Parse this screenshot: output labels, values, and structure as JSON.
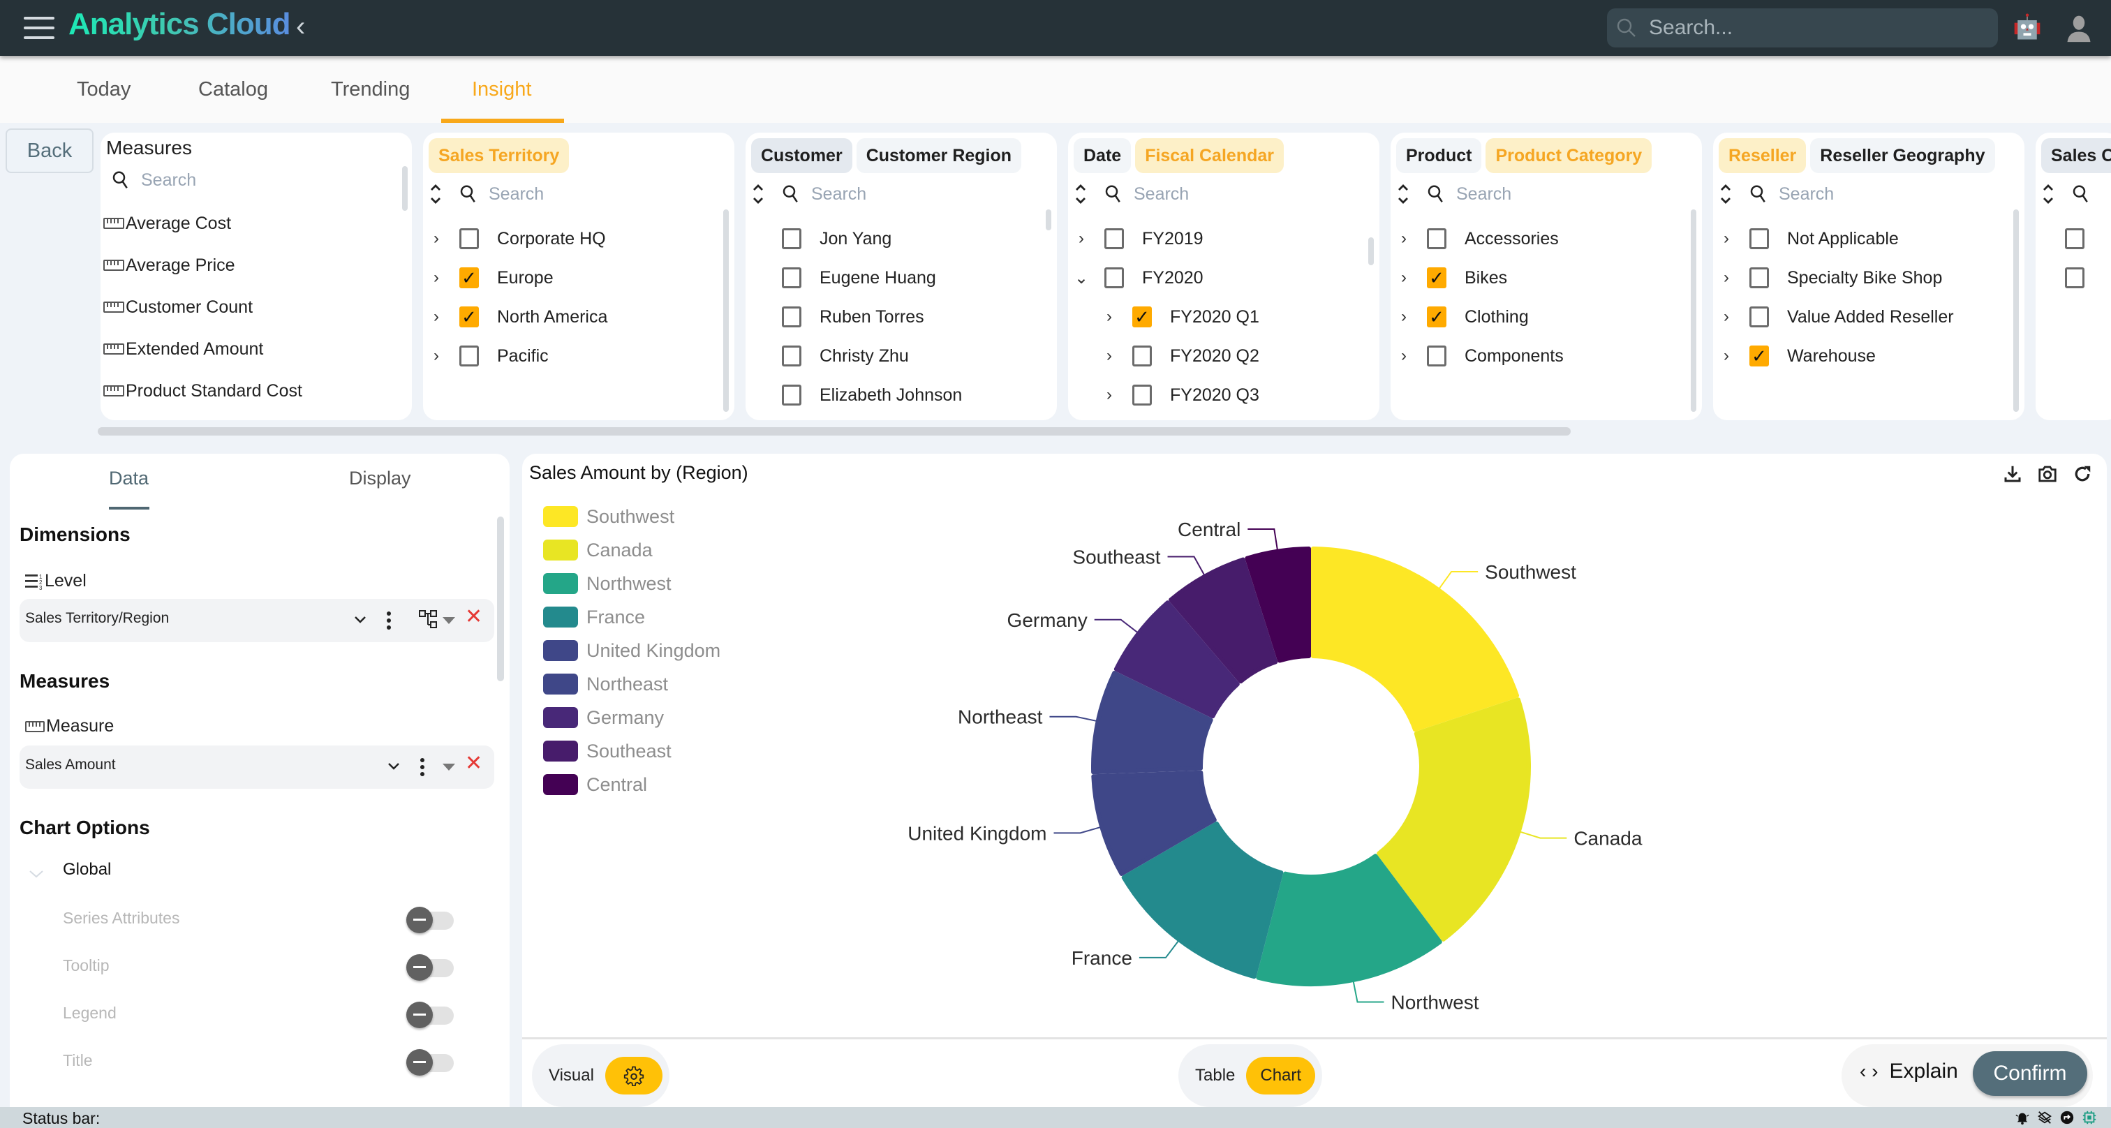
{
  "app": {
    "title": "Analytics Cloud",
    "search_placeholder": "Search..."
  },
  "nav": {
    "tabs": [
      {
        "label": "Today",
        "active": false
      },
      {
        "label": "Catalog",
        "active": false
      },
      {
        "label": "Trending",
        "active": false
      },
      {
        "label": "Insight",
        "active": true
      }
    ]
  },
  "filters": {
    "back_label": "Back",
    "measures_panel": {
      "title": "Measures",
      "search_placeholder": "Search",
      "items": [
        "Average Cost",
        "Average Price",
        "Customer Count",
        "Extended Amount",
        "Product Standard Cost"
      ]
    },
    "search_placeholder": "Search",
    "panels": [
      {
        "chips": [
          {
            "label": "Sales Territory",
            "selected": true
          }
        ],
        "items": [
          {
            "label": "Corporate HQ",
            "checked": false,
            "expander": "›"
          },
          {
            "label": "Europe",
            "checked": true,
            "expander": "›"
          },
          {
            "label": "North America",
            "checked": true,
            "expander": "›"
          },
          {
            "label": "Pacific",
            "checked": false,
            "expander": "›"
          }
        ]
      },
      {
        "chips": [
          {
            "label": "Customer",
            "selected": false,
            "grey": true
          },
          {
            "label": "Customer Region",
            "selected": false
          }
        ],
        "items": [
          {
            "label": "Jon Yang",
            "checked": false,
            "expander": ""
          },
          {
            "label": "Eugene Huang",
            "checked": false,
            "expander": ""
          },
          {
            "label": "Ruben Torres",
            "checked": false,
            "expander": ""
          },
          {
            "label": "Christy Zhu",
            "checked": false,
            "expander": ""
          },
          {
            "label": "Elizabeth Johnson",
            "checked": false,
            "expander": ""
          }
        ]
      },
      {
        "chips": [
          {
            "label": "Date",
            "selected": false
          },
          {
            "label": "Fiscal Calendar",
            "selected": true
          }
        ],
        "items": [
          {
            "label": "FY2019",
            "checked": false,
            "expander": "›",
            "indent": 0
          },
          {
            "label": "FY2020",
            "checked": false,
            "expander": "⌄",
            "indent": 0
          },
          {
            "label": "FY2020 Q1",
            "checked": true,
            "expander": "›",
            "indent": 1
          },
          {
            "label": "FY2020 Q2",
            "checked": false,
            "expander": "›",
            "indent": 1
          },
          {
            "label": "FY2020 Q3",
            "checked": false,
            "expander": "›",
            "indent": 1
          }
        ]
      },
      {
        "chips": [
          {
            "label": "Product",
            "selected": false
          },
          {
            "label": "Product Category",
            "selected": true
          }
        ],
        "items": [
          {
            "label": "Accessories",
            "checked": false,
            "expander": "›"
          },
          {
            "label": "Bikes",
            "checked": true,
            "expander": "›"
          },
          {
            "label": "Clothing",
            "checked": true,
            "expander": "›"
          },
          {
            "label": "Components",
            "checked": false,
            "expander": "›"
          }
        ]
      },
      {
        "chips": [
          {
            "label": "Reseller",
            "selected": true
          },
          {
            "label": "Reseller Geography",
            "selected": false
          }
        ],
        "items": [
          {
            "label": "Not Applicable",
            "checked": false,
            "expander": "›"
          },
          {
            "label": "Specialty Bike Shop",
            "checked": false,
            "expander": "›"
          },
          {
            "label": "Value Added Reseller",
            "checked": false,
            "expander": "›"
          },
          {
            "label": "Warehouse",
            "checked": true,
            "expander": "›"
          }
        ]
      },
      {
        "chips": [
          {
            "label": "Sales O",
            "selected": false,
            "grey": true
          }
        ],
        "items": [
          {
            "label": "",
            "checked": false,
            "expander": ""
          },
          {
            "label": "",
            "checked": false,
            "expander": ""
          }
        ]
      }
    ]
  },
  "config": {
    "tabs": [
      {
        "label": "Data",
        "active": true
      },
      {
        "label": "Display",
        "active": false
      }
    ],
    "dimensions_title": "Dimensions",
    "level_label": "Level",
    "dimension_value": "Sales Territory/Region",
    "measures_title": "Measures",
    "measure_label": "Measure",
    "measure_value": "Sales Amount",
    "chart_options_title": "Chart Options",
    "global_label": "Global",
    "options": [
      {
        "label": "Series Attributes",
        "on": false
      },
      {
        "label": "Tooltip",
        "on": false
      },
      {
        "label": "Legend",
        "on": false
      },
      {
        "label": "Title",
        "on": false
      }
    ]
  },
  "chart_panel": {
    "visual_label": "Visual",
    "table_label": "Table",
    "chart_label": "Chart",
    "explain_label": "Explain",
    "confirm_label": "Confirm"
  },
  "chart_data": {
    "type": "pie",
    "variant": "donut",
    "title": "Sales Amount by (Region)",
    "legend_position": "top-left",
    "unit": "percent of total (estimated from slice angles)",
    "categories": [
      "Southwest",
      "Canada",
      "Northwest",
      "France",
      "United Kingdom",
      "Northeast",
      "Germany",
      "Southeast",
      "Central"
    ],
    "values": [
      19.9,
      19.9,
      14.3,
      12.6,
      7.8,
      7.8,
      6.5,
      6.4,
      4.9
    ],
    "colors": [
      "#fde725",
      "#e8e523",
      "#24a688",
      "#238a8d",
      "#3f4788",
      "#3f4788",
      "#482878",
      "#471c6b",
      "#440154"
    ]
  },
  "status": {
    "text": "Status bar:"
  },
  "colors": {
    "accent": "#ffaa00",
    "header_bg": "#263238",
    "confirm_bg": "#546e7a"
  }
}
